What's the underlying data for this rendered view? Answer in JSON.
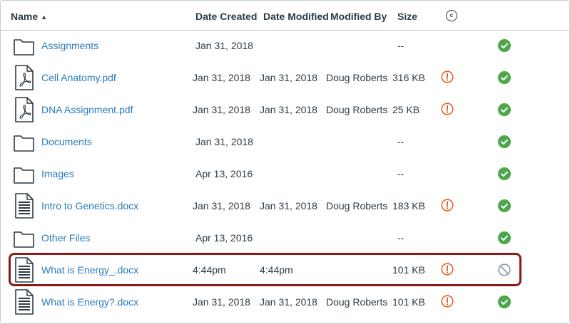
{
  "header": {
    "name": "Name",
    "sort_arrow": "▲",
    "date_created": "Date Created",
    "date_modified": "Date Modified",
    "modified_by": "Modified By",
    "size": "Size",
    "usage_rights_symbol": "c"
  },
  "rows": [
    {
      "type": "folder",
      "name": "Assignments",
      "date_created": "Jan 31, 2018",
      "date_modified": "",
      "modified_by": "",
      "size": "--",
      "warning": false,
      "status": "published"
    },
    {
      "type": "pdf",
      "name": "Cell Anatomy.pdf",
      "date_created": "Jan 31, 2018",
      "date_modified": "Jan 31, 2018",
      "modified_by": "Doug Roberts",
      "size": "316 KB",
      "warning": true,
      "status": "published"
    },
    {
      "type": "pdf",
      "name": "DNA Assignment.pdf",
      "date_created": "Jan 31, 2018",
      "date_modified": "Jan 31, 2018",
      "modified_by": "Doug Roberts",
      "size": "25 KB",
      "warning": true,
      "status": "published"
    },
    {
      "type": "folder",
      "name": "Documents",
      "date_created": "Jan 31, 2018",
      "date_modified": "",
      "modified_by": "",
      "size": "--",
      "warning": false,
      "status": "published"
    },
    {
      "type": "folder",
      "name": "Images",
      "date_created": "Apr 13, 2016",
      "date_modified": "",
      "modified_by": "",
      "size": "--",
      "warning": false,
      "status": "published"
    },
    {
      "type": "doc",
      "name": "Intro to Genetics.docx",
      "date_created": "Jan 31, 2018",
      "date_modified": "Jan 31, 2018",
      "modified_by": "Doug Roberts",
      "size": "183 KB",
      "warning": true,
      "status": "published"
    },
    {
      "type": "folder",
      "name": "Other Files",
      "date_created": "Apr 13, 2016",
      "date_modified": "",
      "modified_by": "",
      "size": "--",
      "warning": false,
      "status": "published"
    },
    {
      "type": "doc",
      "name": "What is Energy_.docx",
      "date_created": "4:44pm",
      "date_modified": "4:44pm",
      "modified_by": "",
      "size": "101 KB",
      "warning": true,
      "status": "unpublished"
    },
    {
      "type": "doc",
      "name": "What is Energy?.docx",
      "date_created": "Jan 31, 2018",
      "date_modified": "Jan 31, 2018",
      "modified_by": "Doug Roberts",
      "size": "101 KB",
      "warning": true,
      "status": "published"
    }
  ],
  "colors": {
    "link": "#2b7abc",
    "text": "#2d3b45",
    "published": "#4ca64c",
    "warning": "#e0632a",
    "highlight": "#8b1a1a",
    "unpublished": "#8b969e"
  }
}
